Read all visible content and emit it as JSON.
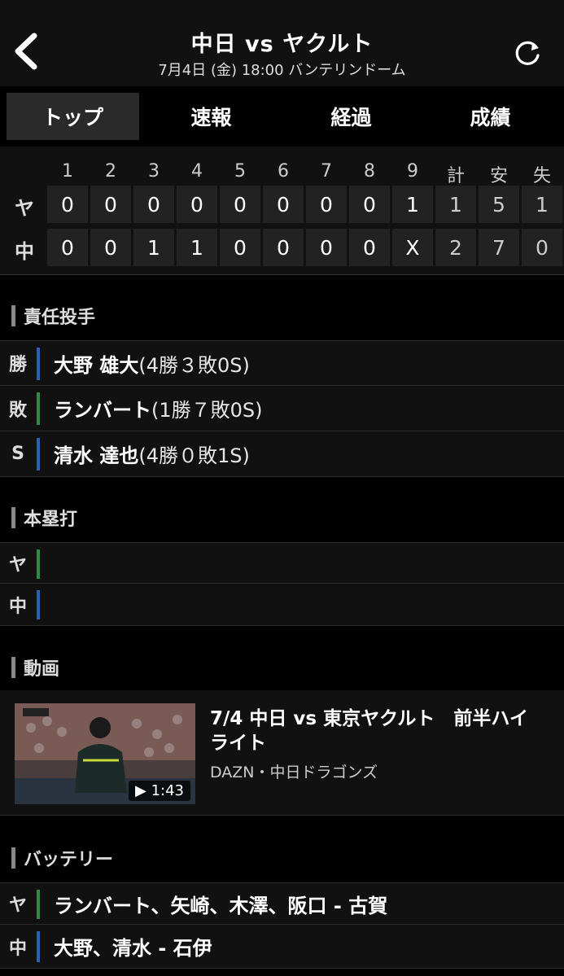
{
  "header": {
    "title": "中日 vs ヤクルト",
    "subtitle": "7月4日 (金) 18:00 バンテリンドーム"
  },
  "tabs": [
    {
      "label": "トップ",
      "active": true
    },
    {
      "label": "速報",
      "active": false
    },
    {
      "label": "経過",
      "active": false
    },
    {
      "label": "成績",
      "active": false
    }
  ],
  "scoreboard": {
    "columns": [
      "1",
      "2",
      "3",
      "4",
      "5",
      "6",
      "7",
      "8",
      "9",
      "計",
      "安",
      "失"
    ],
    "rows": [
      {
        "team": "ヤ",
        "innings": [
          "0",
          "0",
          "0",
          "0",
          "0",
          "0",
          "0",
          "0",
          "1"
        ],
        "totals": [
          "1",
          "5",
          "1"
        ]
      },
      {
        "team": "中",
        "innings": [
          "0",
          "0",
          "1",
          "1",
          "0",
          "0",
          "0",
          "0",
          "X"
        ],
        "totals": [
          "2",
          "7",
          "0"
        ]
      }
    ]
  },
  "pitchers": {
    "title": "責任投手",
    "rows": [
      {
        "key": "勝",
        "name": "大野 雄大",
        "detail": "(4勝３敗0S)"
      },
      {
        "key": "敗",
        "name": "ランバート",
        "detail": "(1勝７敗0S)"
      },
      {
        "key": "S",
        "name": "清水 達也",
        "detail": "(4勝０敗1S)"
      }
    ]
  },
  "homeruns": {
    "title": "本塁打",
    "rows": [
      {
        "key": "ヤ",
        "text": ""
      },
      {
        "key": "中",
        "text": ""
      }
    ]
  },
  "video": {
    "title": "動画",
    "item_title": "7/4 中日 vs 東京ヤクルト　前半ハイライト",
    "source": "DAZN・中日ドラゴンズ",
    "duration": "▶ 1:43"
  },
  "battery": {
    "title": "バッテリー",
    "rows": [
      {
        "key": "ヤ",
        "text": "ランバート、矢崎、木澤、阪口 - 古賀"
      },
      {
        "key": "中",
        "text": "大野、清水 - 石伊"
      }
    ]
  },
  "colors": {
    "win_strip": "#2b5fb3",
    "lose_strip": "#2f8a3e",
    "background": "#000000"
  }
}
